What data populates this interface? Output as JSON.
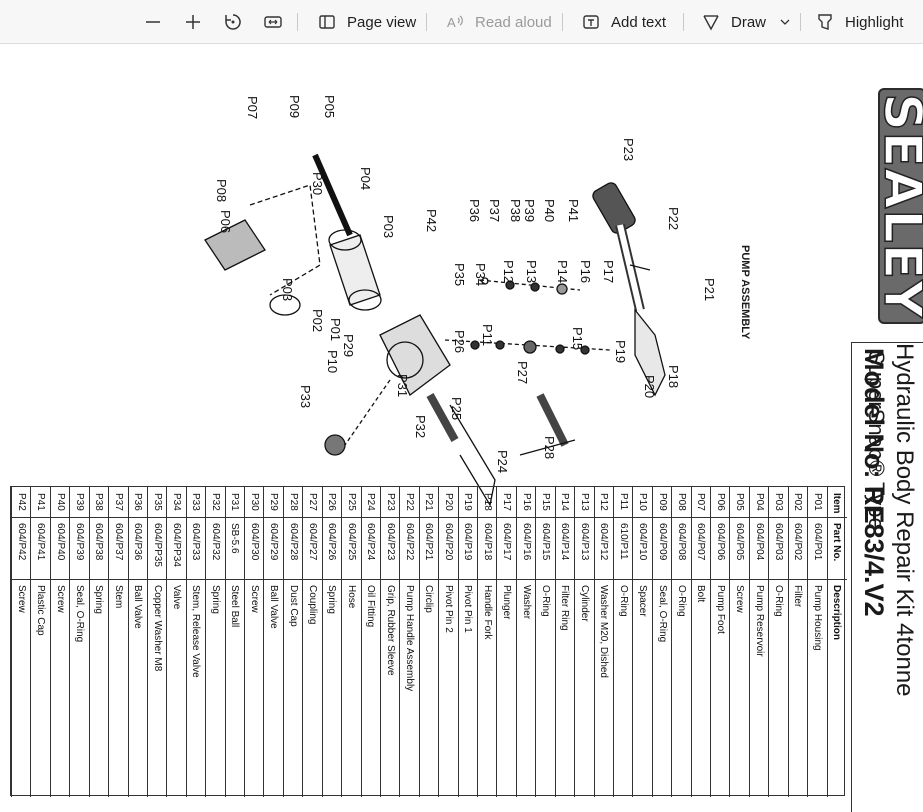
{
  "toolbar": {
    "page_view": "Page view",
    "read_aloud": "Read aloud",
    "add_text": "Add text",
    "draw": "Draw",
    "highlight": "Highlight"
  },
  "document": {
    "brand": "SEALEY",
    "title_line1": "Hydraulic Body Repair Kit 4tonne",
    "title_line2": "SuperSnap® Type",
    "model": "Model No: RE83/4.V2",
    "assembly_title": "PUMP ASSEMBLY",
    "table_headers": {
      "item": "Item",
      "part_no": "Part No.",
      "description": "Description"
    },
    "parts": [
      {
        "item": "P01",
        "part_no": "604/P01",
        "desc": "Pump Housing"
      },
      {
        "item": "P02",
        "part_no": "604/P02",
        "desc": "Filter"
      },
      {
        "item": "P03",
        "part_no": "604/P03",
        "desc": "O-Ring"
      },
      {
        "item": "P04",
        "part_no": "604/P04",
        "desc": "Pump Reservoir"
      },
      {
        "item": "P05",
        "part_no": "604/P05",
        "desc": "Screw"
      },
      {
        "item": "P06",
        "part_no": "604/P06",
        "desc": "Pump Foot"
      },
      {
        "item": "P07",
        "part_no": "604/P07",
        "desc": "Bolt"
      },
      {
        "item": "P08",
        "part_no": "604/P08",
        "desc": "O-Ring"
      },
      {
        "item": "P09",
        "part_no": "604/P09",
        "desc": "Seal, O-Ring"
      },
      {
        "item": "P10",
        "part_no": "604/P10",
        "desc": "Spacer"
      },
      {
        "item": "P11",
        "part_no": "610/P11",
        "desc": "O-Ring"
      },
      {
        "item": "P12",
        "part_no": "604/P12",
        "desc": "Washer M20, Dished"
      },
      {
        "item": "P13",
        "part_no": "604/P13",
        "desc": "Cylinder"
      },
      {
        "item": "P14",
        "part_no": "604/P14",
        "desc": "Filter Ring"
      },
      {
        "item": "P15",
        "part_no": "604/P15",
        "desc": "O-Ring"
      },
      {
        "item": "P16",
        "part_no": "604/P16",
        "desc": "Washer"
      },
      {
        "item": "P17",
        "part_no": "604/P17",
        "desc": "Plunger"
      },
      {
        "item": "P18",
        "part_no": "604/P18",
        "desc": "Handle Fork"
      },
      {
        "item": "P19",
        "part_no": "604/P19",
        "desc": "Pivot Pin 1"
      },
      {
        "item": "P20",
        "part_no": "604/P20",
        "desc": "Pivot Pin 2"
      },
      {
        "item": "P21",
        "part_no": "604/P21",
        "desc": "Circlip"
      },
      {
        "item": "P22",
        "part_no": "604/P22",
        "desc": "Pump Handle Assembly"
      },
      {
        "item": "P23",
        "part_no": "604/P23",
        "desc": "Grip, Rubber Sleeve"
      },
      {
        "item": "P24",
        "part_no": "604/P24",
        "desc": "Oil Fitting"
      },
      {
        "item": "P25",
        "part_no": "604/P25",
        "desc": "Hose"
      },
      {
        "item": "P26",
        "part_no": "604/P26",
        "desc": "Spring"
      },
      {
        "item": "P27",
        "part_no": "604/P27",
        "desc": "Coupling"
      },
      {
        "item": "P28",
        "part_no": "604/P28",
        "desc": "Dust Cap"
      },
      {
        "item": "P29",
        "part_no": "604/P29",
        "desc": "Ball Valve"
      },
      {
        "item": "P30",
        "part_no": "604/P30",
        "desc": "Screw"
      },
      {
        "item": "P31",
        "part_no": "SB-5.6",
        "desc": "Steel Ball"
      },
      {
        "item": "P32",
        "part_no": "604/P32",
        "desc": "Spring"
      },
      {
        "item": "P33",
        "part_no": "604/P33",
        "desc": "Stem, Release Valve"
      },
      {
        "item": "P34",
        "part_no": "604/PP34",
        "desc": "Valve"
      },
      {
        "item": "P35",
        "part_no": "604/PP35",
        "desc": "Copper Washer M8"
      },
      {
        "item": "P36",
        "part_no": "604/P36",
        "desc": "Ball Valve"
      },
      {
        "item": "P37",
        "part_no": "604/P37",
        "desc": "Stem"
      },
      {
        "item": "P38",
        "part_no": "604/P38",
        "desc": "Spring"
      },
      {
        "item": "P39",
        "part_no": "604/P39",
        "desc": "Seal, O-Ring"
      },
      {
        "item": "P40",
        "part_no": "604/P40",
        "desc": "Screw"
      },
      {
        "item": "P41",
        "part_no": "604/P41",
        "desc": "Plastic Cap"
      },
      {
        "item": "P42",
        "part_no": "604/P42",
        "desc": "Screw"
      }
    ],
    "callouts": [
      {
        "id": "P01",
        "label": "P01"
      },
      {
        "id": "P02",
        "label": "P02"
      },
      {
        "id": "P03a",
        "label": "P03"
      },
      {
        "id": "P03b",
        "label": "P03"
      },
      {
        "id": "P04",
        "label": "P04"
      },
      {
        "id": "P05",
        "label": "P05"
      },
      {
        "id": "P06",
        "label": "P06"
      },
      {
        "id": "P07",
        "label": "P07"
      },
      {
        "id": "P08",
        "label": "P08"
      },
      {
        "id": "P09",
        "label": "P09"
      },
      {
        "id": "P10",
        "label": "P10"
      },
      {
        "id": "P11",
        "label": "P11"
      },
      {
        "id": "P12",
        "label": "P12"
      },
      {
        "id": "P13",
        "label": "P13"
      },
      {
        "id": "P14",
        "label": "P14"
      },
      {
        "id": "P15",
        "label": "P15"
      },
      {
        "id": "P16",
        "label": "P16"
      },
      {
        "id": "P17",
        "label": "P17"
      },
      {
        "id": "P18",
        "label": "P18"
      },
      {
        "id": "P19",
        "label": "P19"
      },
      {
        "id": "P20",
        "label": "P20"
      },
      {
        "id": "P21",
        "label": "P21"
      },
      {
        "id": "P22",
        "label": "P22"
      },
      {
        "id": "P23",
        "label": "P23"
      },
      {
        "id": "P24",
        "label": "P24"
      },
      {
        "id": "P25",
        "label": "P25"
      },
      {
        "id": "P26",
        "label": "P26"
      },
      {
        "id": "P27",
        "label": "P27"
      },
      {
        "id": "P28",
        "label": "P28"
      },
      {
        "id": "P29",
        "label": "P29"
      },
      {
        "id": "P30",
        "label": "P30"
      },
      {
        "id": "P31",
        "label": "P31"
      },
      {
        "id": "P32",
        "label": "P32"
      },
      {
        "id": "P33",
        "label": "P33"
      },
      {
        "id": "P34",
        "label": "P34"
      },
      {
        "id": "P35",
        "label": "P35"
      },
      {
        "id": "P36",
        "label": "P36"
      },
      {
        "id": "P37",
        "label": "P37"
      },
      {
        "id": "P38",
        "label": "P38"
      },
      {
        "id": "P39",
        "label": "P39"
      },
      {
        "id": "P40",
        "label": "P40"
      },
      {
        "id": "P41",
        "label": "P41"
      },
      {
        "id": "P42",
        "label": "P42"
      }
    ]
  }
}
